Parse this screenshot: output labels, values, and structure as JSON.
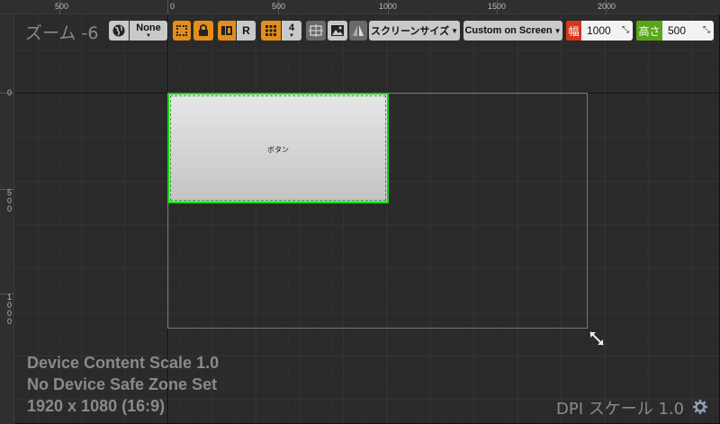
{
  "ruler": {
    "top_labels": [
      "500",
      "0",
      "500",
      "1000",
      "1500",
      "2000"
    ],
    "left_labels": [
      "0",
      "500",
      "1000"
    ]
  },
  "zoom_label": "ズーム -6",
  "toolbar": {
    "localization_value": "None",
    "flipbook_button_label": "R",
    "grid_snap_value": "4",
    "screen_size_label": "スクリーンサイズ",
    "fill_mode_value": "Custom on Screen",
    "width_label": "幅",
    "width_value": "1000",
    "height_label": "高さ",
    "height_value": "500"
  },
  "widget": {
    "label": "ボタン"
  },
  "info": {
    "content_scale": "Device Content Scale 1.0",
    "safe_zone": "No Device Safe Zone Set",
    "resolution": "1920 x 1080 (16:9)"
  },
  "dpi_label": "DPI スケール 1.0",
  "colors": {
    "accent_orange": "#e38d1c",
    "width_red": "#d8361b",
    "height_green": "#5aa61a",
    "selection_green": "#19d019"
  }
}
